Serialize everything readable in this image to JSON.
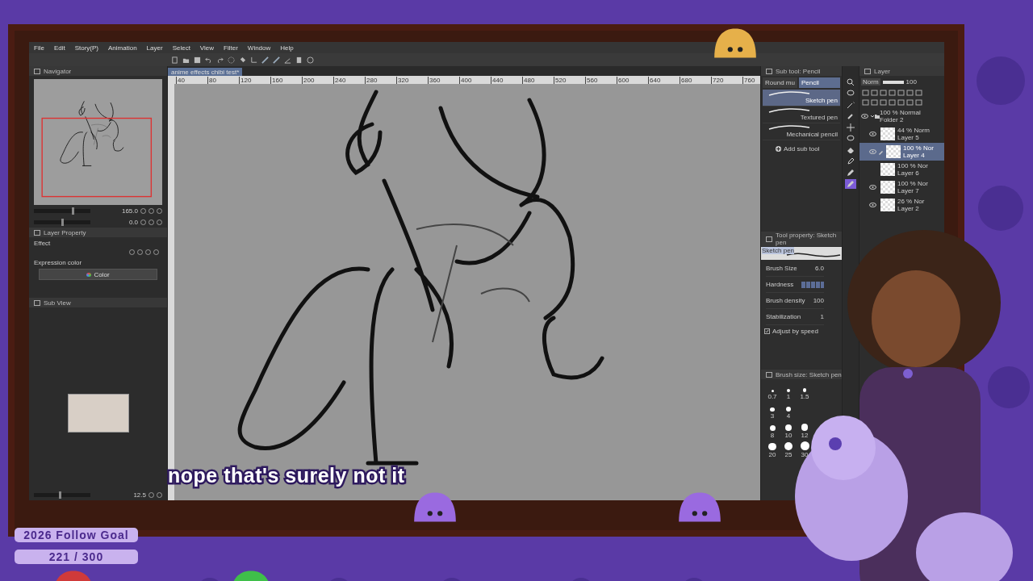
{
  "app": {
    "menu": [
      "File",
      "Edit",
      "Story(P)",
      "Animation",
      "Layer",
      "Select",
      "View",
      "Filter",
      "Window",
      "Help"
    ],
    "document_tab": "anime effects chibi test*",
    "ruler_marks": [
      "40",
      "80",
      "120",
      "160",
      "200",
      "240",
      "280",
      "320",
      "360",
      "400",
      "440",
      "480",
      "520",
      "560",
      "600",
      "640",
      "680",
      "720",
      "760"
    ],
    "navigator": {
      "title": "Navigator",
      "zoom": "165.0",
      "zoom_slider": {
        "level": 0.68
      },
      "rotation": "0.0",
      "rotation_slider": {
        "level": 0.5
      }
    },
    "layer_property": {
      "title": "Layer Property",
      "section": "Effect",
      "expression_label": "Expression color",
      "expression_value": "Color"
    },
    "sub_view": {
      "title": "Sub View",
      "zoom": "12.5",
      "zoom_slider": {
        "level": 0.45
      }
    },
    "sub_tool": {
      "title": "Sub tool: Pencil",
      "tabs": [
        {
          "label": "Round mu",
          "selected": false
        },
        {
          "label": "Pencil",
          "selected": true
        }
      ],
      "items": [
        {
          "label": "Sketch pen",
          "selected": true
        },
        {
          "label": "Textured pen",
          "selected": false
        },
        {
          "label": "Mechanical pencil",
          "selected": false
        }
      ],
      "add_label": "Add sub tool"
    },
    "tool_property": {
      "title": "Tool property: Sketch pen",
      "preview_label": "Sketch pen",
      "rows": [
        {
          "kind": "value",
          "label": "Brush Size",
          "value": "6.0"
        },
        {
          "kind": "blocks",
          "label": "Hardness",
          "level": 1
        },
        {
          "kind": "value",
          "label": "Brush density",
          "value": "100"
        },
        {
          "kind": "value",
          "label": "Stabilization",
          "value": "1"
        },
        {
          "kind": "checkbox",
          "label": "Adjust by speed",
          "checked": true
        }
      ]
    },
    "brush_size": {
      "title": "Brush size: Sketch pen",
      "sizes": [
        "0.7",
        "1",
        "1.5",
        "3",
        "4",
        "8",
        "10",
        "12",
        "20",
        "25",
        "30"
      ]
    },
    "tools": [
      {
        "kind": "zoom",
        "selected": false
      },
      {
        "kind": "lasso",
        "selected": false
      },
      {
        "kind": "wand",
        "selected": false
      },
      {
        "kind": "eyedropper",
        "selected": false
      },
      {
        "kind": "move",
        "selected": false
      },
      {
        "kind": "lasso",
        "selected": false
      },
      {
        "kind": "eraser",
        "selected": false
      },
      {
        "kind": "pen",
        "selected": false
      },
      {
        "kind": "pencil",
        "selected": false
      },
      {
        "kind": "pencil",
        "selected": true
      }
    ],
    "layers": {
      "title": "Layer",
      "blend": "Norm",
      "opacity": "100",
      "opacity_slider": {
        "level": 1
      },
      "items": [
        {
          "kind": "folder",
          "name": "Folder 2",
          "mode": "100 % Normal",
          "visible": true,
          "selected": false,
          "expanded": true,
          "children": [
            {
              "kind": "layer",
              "name": "Layer 5",
              "mode": "44 % Norm",
              "visible": true,
              "selected": false
            },
            {
              "kind": "layer",
              "name": "Layer 4",
              "mode": "100 % Nor",
              "visible": true,
              "selected": true
            },
            {
              "kind": "layer",
              "name": "Layer 6",
              "mode": "100 % Nor",
              "visible": false,
              "selected": false
            },
            {
              "kind": "layer",
              "name": "Layer 7",
              "mode": "100 % Nor",
              "visible": true,
              "selected": false
            },
            {
              "kind": "layer",
              "name": "Layer 2",
              "mode": "26 % Nor",
              "visible": true,
              "selected": false
            }
          ]
        }
      ]
    }
  },
  "overlay": {
    "caption": "nope that's surely not it",
    "goal_title": "2026 Follow Goal",
    "goal_count": "221 / 300"
  }
}
